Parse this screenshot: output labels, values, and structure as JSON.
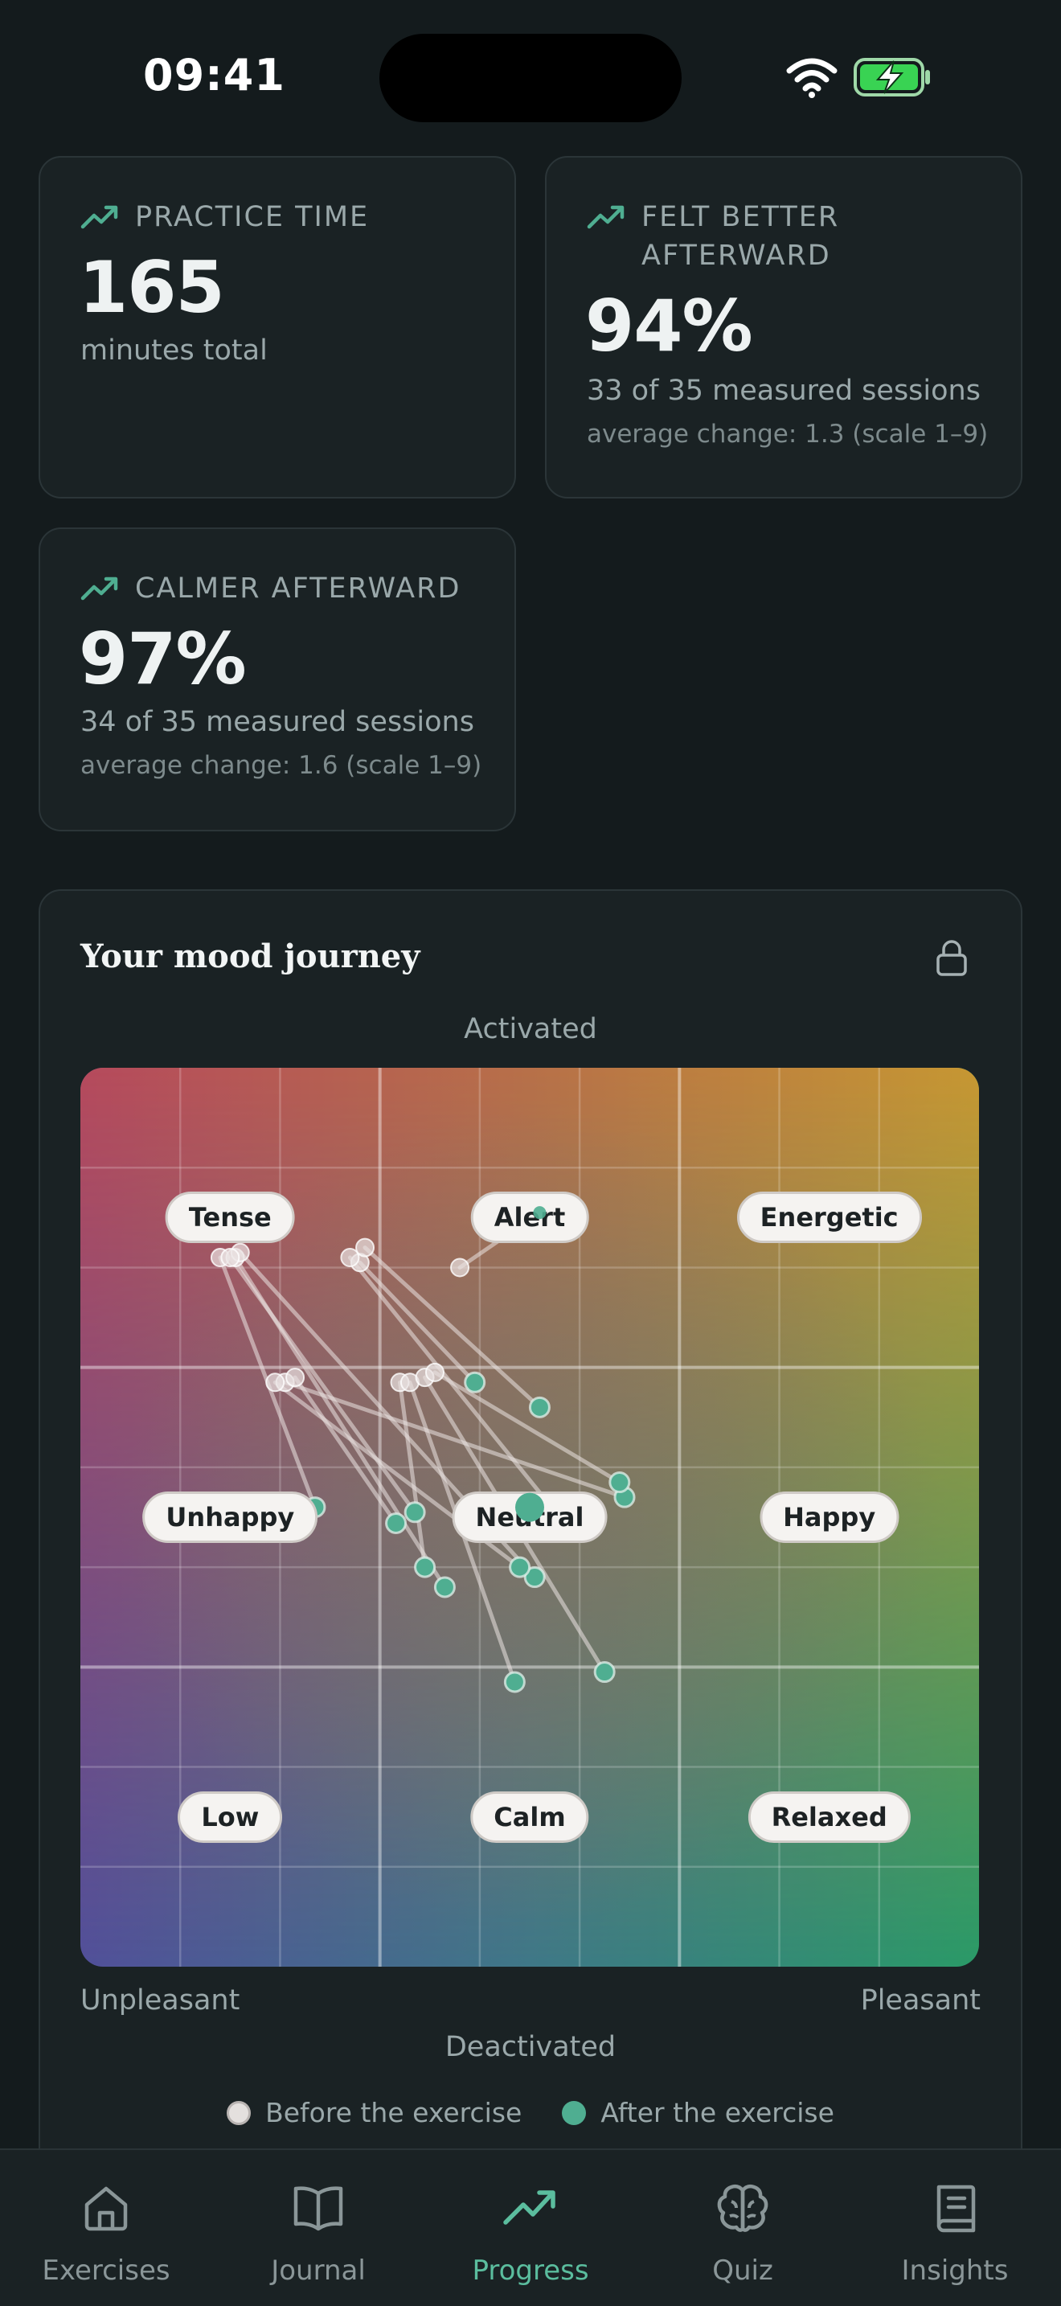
{
  "status_bar": {
    "time": "09:41"
  },
  "stats": {
    "practice_time": {
      "label": "PRACTICE TIME",
      "value": "165",
      "sub": "minutes total"
    },
    "felt_better": {
      "label": "FELT BETTER AFTERWARD",
      "value": "94%",
      "sub": "33 of 35 measured sessions",
      "avg": "average change: 1.3 (scale 1–9)"
    },
    "calmer": {
      "label": "CALMER AFTERWARD",
      "value": "97%",
      "sub": "34 of 35 measured sessions",
      "avg": "average change: 1.6 (scale 1–9)"
    }
  },
  "mood_journey": {
    "title": "Your mood journey",
    "axis_top": "Activated",
    "axis_bottom": "Deactivated",
    "axis_left": "Unpleasant",
    "axis_right": "Pleasant",
    "moods": [
      "Tense",
      "Alert",
      "Energetic",
      "Unhappy",
      "Neutral",
      "Happy",
      "Low",
      "Calm",
      "Relaxed"
    ],
    "legend": {
      "before": "Before the exercise",
      "after": "After the exercise"
    },
    "colors": {
      "before": "#e9e3e3",
      "after": "#4fae91"
    }
  },
  "chart_data": {
    "type": "scatter",
    "x_range": [
      0,
      9
    ],
    "y_range": [
      0,
      9
    ],
    "series": [
      {
        "name": "Before the exercise",
        "values": []
      },
      {
        "name": "After the exercise",
        "values": []
      }
    ],
    "sessions": [
      {
        "before": [
          1.4,
          7.1
        ],
        "after": [
          2.35,
          4.6
        ]
      },
      {
        "before": [
          1.55,
          7.1
        ],
        "after": [
          3.65,
          3.8
        ]
      },
      {
        "before": [
          1.6,
          7.15
        ],
        "after": [
          4.55,
          3.9
        ]
      },
      {
        "before": [
          1.5,
          7.1
        ],
        "after": [
          3.35,
          4.55
        ]
      },
      {
        "before": [
          2.8,
          7.05
        ],
        "after": [
          3.95,
          5.85
        ]
      },
      {
        "before": [
          2.7,
          7.1
        ],
        "after": [
          4.8,
          4.5
        ]
      },
      {
        "before": [
          2.85,
          7.2
        ],
        "after": [
          4.6,
          5.6
        ]
      },
      {
        "before": [
          2.05,
          5.85
        ],
        "after": [
          5.45,
          4.7
        ]
      },
      {
        "before": [
          2.15,
          5.9
        ],
        "after": [
          3.16,
          4.44
        ]
      },
      {
        "before": [
          1.95,
          5.85
        ],
        "after": [
          4.4,
          4.0
        ]
      },
      {
        "before": [
          3.2,
          5.85
        ],
        "after": [
          3.45,
          4.0
        ]
      },
      {
        "before": [
          3.3,
          5.85
        ],
        "after": [
          4.35,
          2.85
        ]
      },
      {
        "before": [
          3.45,
          5.9
        ],
        "after": [
          5.25,
          2.95
        ]
      },
      {
        "before": [
          3.55,
          5.95
        ],
        "after": [
          5.4,
          4.85
        ]
      },
      {
        "before": [
          3.8,
          7.0
        ],
        "after": [
          4.6,
          7.55
        ]
      }
    ],
    "latest_after": [
      4.5,
      4.6
    ]
  },
  "nav": {
    "items": [
      {
        "label": "Exercises"
      },
      {
        "label": "Journal"
      },
      {
        "label": "Progress"
      },
      {
        "label": "Quiz"
      },
      {
        "label": "Insights"
      }
    ]
  }
}
